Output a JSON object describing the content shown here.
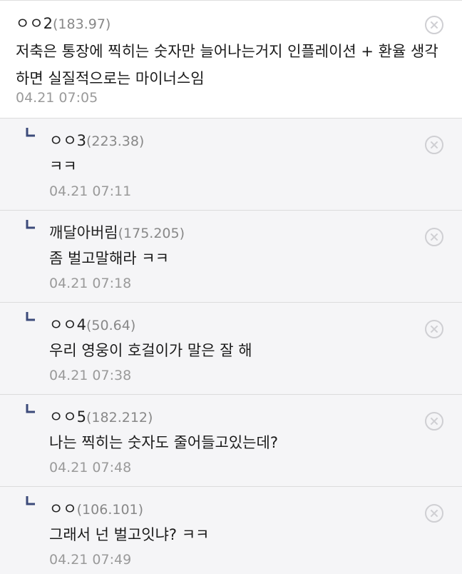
{
  "comments": [
    {
      "author": "ㅇㅇ2",
      "ip": "(183.97)",
      "text": "저축은 통장에 찍히는 숫자만 늘어나는거지 인플레이션 + 환율 생각하면 실질적으로는 마이너스임",
      "time": "04.21 07:05"
    }
  ],
  "replies": [
    {
      "author": "ㅇㅇ3",
      "ip": "(223.38)",
      "text": "ㅋㅋ",
      "time": "04.21 07:11"
    },
    {
      "author": "깨달아버림",
      "ip": "(175.205)",
      "text": "좀 벌고말해라 ㅋㅋ",
      "time": "04.21 07:18"
    },
    {
      "author": "ㅇㅇ4",
      "ip": "(50.64)",
      "text": "우리 영웅이 호걸이가 말은 잘 해",
      "time": "04.21 07:38"
    },
    {
      "author": "ㅇㅇ5",
      "ip": "(182.212)",
      "text": "나는 찍히는 숫자도 줄어들고있는데?",
      "time": "04.21 07:48"
    },
    {
      "author": "ㅇㅇ",
      "ip": "(106.101)",
      "text": "그래서 넌 벌고잇냐? ㅋㅋ",
      "time": "04.21 07:49"
    }
  ],
  "icons": {
    "reply": "reply-arrow-icon",
    "delete": "close-circle-icon"
  },
  "colors": {
    "reply_background": "#f5f5f7",
    "reply_marker": "#3c4a7a",
    "ip_text": "#888888",
    "timestamp": "#9a9a9a"
  }
}
